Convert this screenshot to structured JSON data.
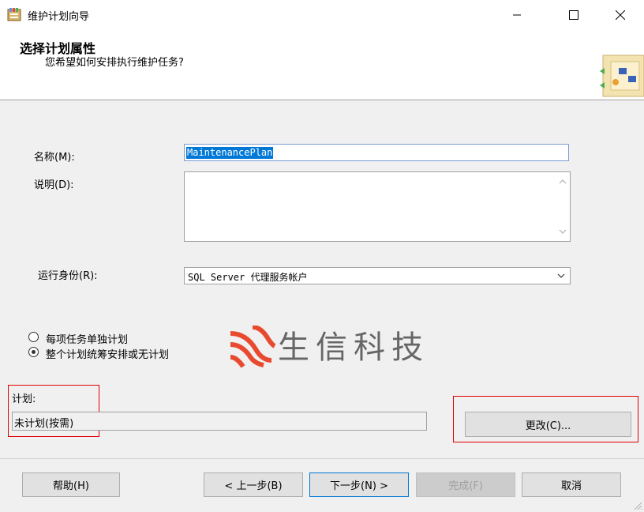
{
  "window": {
    "title": "维护计划向导"
  },
  "header": {
    "title": "选择计划属性",
    "subtitle": "您希望如何安排执行维护任务?"
  },
  "form": {
    "name_label": "名称(M):",
    "name_value": "MaintenancePlan",
    "desc_label": "说明(D):",
    "desc_value": "",
    "runas_label": "运行身份(R):",
    "runas_value": "SQL Server 代理服务帐户"
  },
  "schedule_options": [
    {
      "label": "每项任务单独计划",
      "selected": false
    },
    {
      "label": "整个计划统筹安排或无计划",
      "selected": true
    }
  ],
  "watermark": {
    "text": "生信科技",
    "color": "#e84a2f"
  },
  "schedule": {
    "label": "计划:",
    "value": "未计划(按需)",
    "change_button": "更改(C)..."
  },
  "buttons": {
    "help": "帮助(H)",
    "back": "< 上一步(B)",
    "next": "下一步(N) >",
    "finish": "完成(F)",
    "cancel": "取消"
  },
  "colors": {
    "highlight": "#e00000",
    "selection": "#0078d7",
    "focus_border": "#0078d7"
  }
}
